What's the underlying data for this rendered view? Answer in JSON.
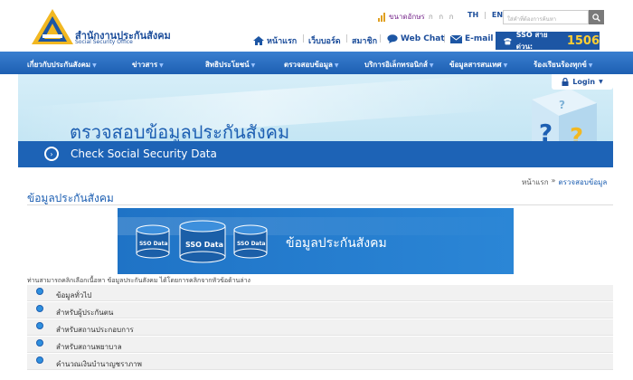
{
  "header": {
    "org_name_th": "สำนักงานประกันสังคม",
    "org_name_en": "Social Security Office",
    "font_size_label": "ขนาดอักษร",
    "font_size_glyphs": "ก ก ก",
    "lang_th": "TH",
    "lang_sep": "|",
    "lang_en": "EN",
    "search_placeholder": "ใส่คำที่ต้องการค้นหา",
    "quick_links": {
      "home": "หน้าแรก",
      "webboard": "เว็บบอร์ด",
      "member": "สมาชิก",
      "webchat": "Web Chat",
      "email": "E-mail"
    },
    "sep": "|",
    "hotline_label": "SSO สายด่วน:",
    "hotline_number": "1506"
  },
  "nav": {
    "items": [
      "เกี่ยวกับประกันสังคม",
      "ข่าวสาร",
      "สิทธิประโยชน์",
      "ตรวจสอบข้อมูล",
      "บริการอิเล็กทรอนิกส์",
      "ข้อมูลสารสนเทศ",
      "ร้องเรียนร้องทุกข์"
    ]
  },
  "banner": {
    "title_th": "ตรวจสอบข้อมูลประกันสังคม",
    "title_en": "Check Social Security Data",
    "login_label": "Login"
  },
  "breadcrumb": {
    "home": "หน้าแรก",
    "arrow": "»",
    "current": "ตรวจสอบข้อมูล"
  },
  "section": {
    "title": "ข้อมูลประกันสังคม"
  },
  "sso_banner": {
    "cyl_left": "SSO Data",
    "cyl_center": "SSO Data",
    "cyl_right": "SSO Data",
    "title": "ข้อมูลประกันสังคม"
  },
  "intro": "ท่านสามารถคลิกเลือกเนื้อหา ข้อมูลประกันสังคม ได้โดยการคลิกจากหัวข้อด้านล่าง",
  "list": [
    "ข้อมูลทั่วไป",
    "สำหรับผู้ประกันตน",
    "สำหรับสถานประกอบการ",
    "สำหรับสถานพยาบาล",
    "คำนวณเงินบำนาญชราภาพ"
  ],
  "colors": {
    "brand_blue": "#1d5fb2",
    "nav_blue": "#2a6fc4",
    "hotline_yellow": "#ffcf32",
    "banner_bg": "#cdeaf6"
  }
}
